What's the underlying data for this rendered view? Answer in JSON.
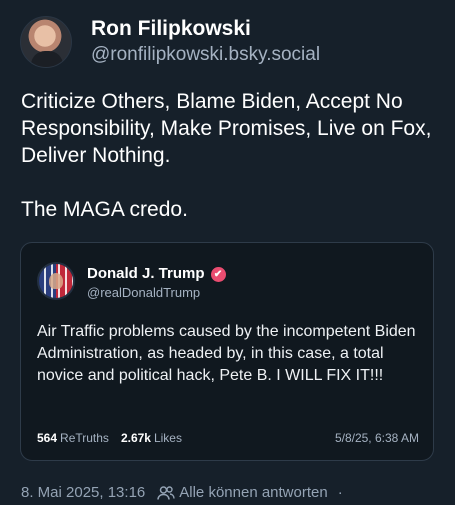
{
  "post": {
    "author": {
      "display_name": "Ron Filipkowski",
      "handle": "@ronfilipkowski.bsky.social"
    },
    "text_lines": [
      "Criticize Others, Blame Biden, Accept No Responsibility, Make Promises, Live on Fox, Deliver Nothing.",
      "The MAGA credo."
    ],
    "quote": {
      "author": {
        "display_name": "Donald J. Trump",
        "handle": "@realDonaldTrump",
        "verified_icon": "check-badge-icon",
        "verified_color": "#ea4c70"
      },
      "text": "Air Traffic problems caused by the incompetent Biden Administration, as headed by, in this case, a total novice and political hack, Pete B. I WILL FIX IT!!!",
      "retruths_count": "564",
      "retruths_label": "ReTruths",
      "likes_count": "2.67k",
      "likes_label": "Likes",
      "date": "5/8/25, 6:38 AM"
    },
    "meta": {
      "timestamp": "8. Mai 2025, 13:16",
      "audience_icon": "people-icon",
      "audience": "Alle können antworten",
      "separator": "·"
    }
  },
  "colors": {
    "background": "#16202a",
    "secondary_text": "#a5b2c2",
    "card_border": "#2e3b49"
  }
}
